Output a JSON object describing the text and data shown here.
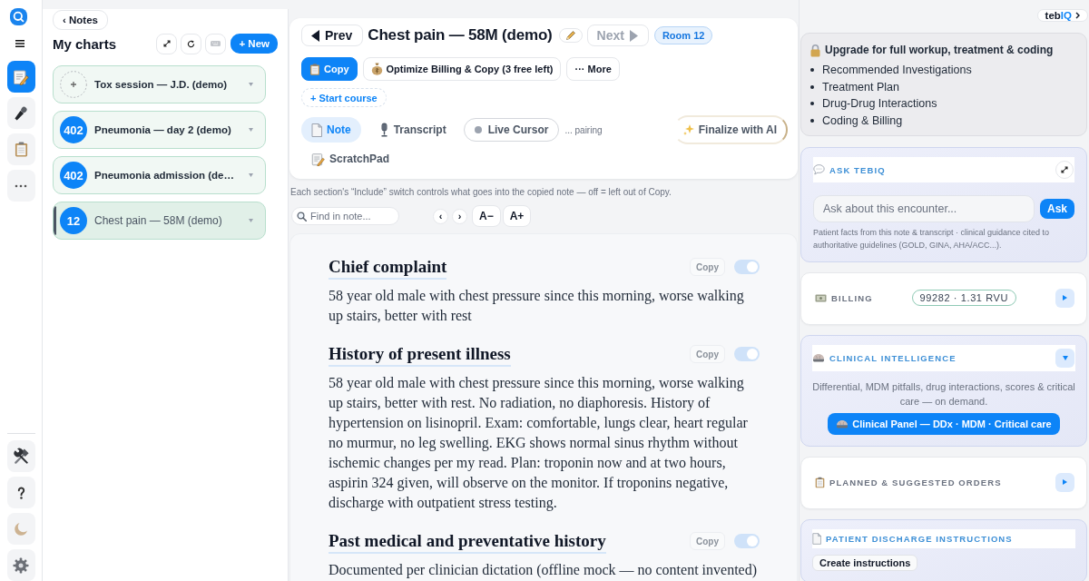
{
  "rail": {
    "items": [
      {
        "kind": "notes",
        "selected": true
      },
      {
        "kind": "dictation",
        "selected": false
      },
      {
        "kind": "clipboard",
        "selected": false
      },
      {
        "kind": "more",
        "selected": false
      }
    ],
    "bottom": [
      {
        "kind": "tools"
      },
      {
        "kind": "help"
      },
      {
        "kind": "theme"
      },
      {
        "kind": "settings"
      }
    ]
  },
  "charts": {
    "back_button": "‹ Notes",
    "title": "My charts",
    "new_button": "+ New",
    "items": [
      {
        "kind": "new",
        "title": "Tox session — J.D. (demo)",
        "selected": false
      },
      {
        "kind": "room",
        "room": "402",
        "title": "Pneumonia — day 2 (demo)",
        "selected": false
      },
      {
        "kind": "room",
        "room": "402",
        "title": "Pneumonia admission (de…",
        "selected": false
      },
      {
        "kind": "room",
        "room": "12",
        "title": "Chest pain — 58M (demo)",
        "selected": true
      }
    ]
  },
  "encounter": {
    "prev_button": {
      "label": "Prev",
      "disabled": false
    },
    "title": "Chest pain — 58M (demo)",
    "next_button": {
      "label": "Next",
      "disabled": true
    },
    "room_tag": "Room 12",
    "actions": [
      {
        "kind": "copy",
        "label": "Copy"
      },
      {
        "kind": "billing",
        "label": "Optimize Billing & Copy (3 free left)"
      },
      {
        "kind": "more",
        "label": "··· More"
      }
    ],
    "start_course": "+ Start course",
    "tabs": [
      {
        "kind": "note",
        "label": "Note",
        "selected": true
      },
      {
        "kind": "transcript",
        "label": "Transcript",
        "selected": false
      }
    ],
    "live_cursor": {
      "label": "Live Cursor",
      "on": false
    },
    "pairing_status": "... pairing",
    "finalize_button": "Finalize with AI",
    "more_tabs": [
      {
        "kind": "scratchpad",
        "label": "ScratchPad",
        "selected": false
      }
    ]
  },
  "include_hint": "Each section's “Include” switch controls what goes into the copied note — off = left out of Copy.",
  "find": {
    "placeholder": "Find in note...",
    "prev": "‹",
    "next": "›",
    "smaller": "A−",
    "larger": "A+"
  },
  "note": {
    "sections": [
      {
        "heading": "Chief complaint",
        "copy": "Copy",
        "include": true,
        "body": "58 year old male with chest pressure since this morning, worse walking up stairs, better with rest"
      },
      {
        "heading": "History of present illness",
        "copy": "Copy",
        "include": true,
        "body": "58 year old male with chest pressure since this morning, worse walking up stairs, better with rest. No radiation, no diaphoresis. History of hypertension on lisinopril. Exam: comfortable, lungs clear, heart regular no murmur, no leg swelling. EKG shows normal sinus rhythm without ischemic changes per my read. Plan: troponin now and at two hours, aspirin 324 given, will observe on the monitor. If troponins negative, discharge with outpatient stress testing."
      },
      {
        "heading": "Past medical and preventative history",
        "copy": "Copy",
        "include": true,
        "body": "Documented per clinician dictation (offline mock — no content invented)"
      }
    ]
  },
  "side": {
    "brand": {
      "name": "teb",
      "accent": "IQ"
    },
    "upgrade": {
      "title": "Upgrade for full workup, treatment & coding",
      "items": [
        "Recommended Investigations",
        "Treatment Plan",
        "Drug-Drug Interactions",
        "Coding & Billing"
      ]
    },
    "ask": {
      "title": "ASK TEBIQ",
      "placeholder": "Ask about this encounter...",
      "button": "Ask",
      "note": "Patient facts from this note & transcript · clinical guidance cited to authoritative guidelines (GOLD, GINA, AHA/ACC...)."
    },
    "cards": [
      {
        "kind": "billing",
        "title": "BILLING",
        "tag": "99282 · 1.31 RVU",
        "expanded": false
      },
      {
        "kind": "clinical",
        "title": "CLINICAL INTELLIGENCE",
        "expanded": true,
        "text": "Differential, MDM pitfalls, drug interactions, scores & critical care — on demand.",
        "button": "Clinical Panel — DDx · MDM · Critical care"
      },
      {
        "kind": "orders",
        "title": "PLANNED & SUGGESTED ORDERS",
        "expanded": false
      },
      {
        "kind": "discharge",
        "title": "PATIENT DISCHARGE INSTRUCTIONS",
        "expanded": true,
        "button": "Create instructions"
      }
    ]
  }
}
